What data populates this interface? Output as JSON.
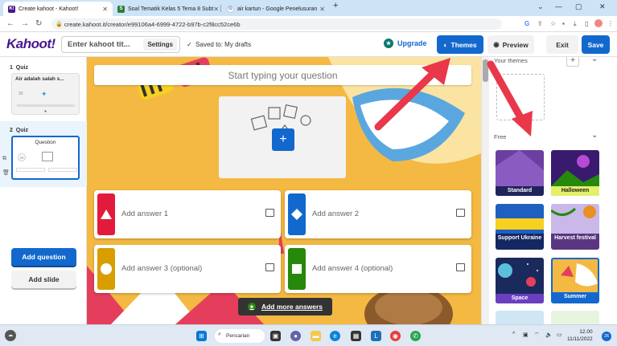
{
  "browser": {
    "tabs": [
      {
        "title": "Create kahoot - Kahoot!",
        "favicon": "K!",
        "active": true
      },
      {
        "title": "Soal Tematik Kelas 5 Tema 8 Subt",
        "favicon": "S",
        "active": false
      },
      {
        "title": "air kartun - Google Penelusuran",
        "favicon": "G",
        "active": false
      }
    ],
    "new_tab": "+",
    "url": "create.kahoot.it/creator/e99106a4-6999-4722-b97b-c2f8cc52ce6b"
  },
  "header": {
    "logo": "Kahoot!",
    "title_placeholder": "Enter kahoot tit...",
    "settings_label": "Settings",
    "saved_status": "Saved to: My drafts",
    "upgrade_label": "Upgrade",
    "themes_label": "Themes",
    "preview_label": "Preview",
    "exit_label": "Exit",
    "save_label": "Save"
  },
  "sidebar": {
    "slides": [
      {
        "index": "1",
        "type": "Quiz",
        "title": "Air adalah salah s...",
        "time": "20"
      },
      {
        "index": "2",
        "type": "Quiz",
        "title": "Question",
        "time": "20"
      }
    ],
    "add_question_label": "Add question",
    "add_slide_label": "Add slide"
  },
  "editor": {
    "question_placeholder": "Start typing your question",
    "answers": [
      {
        "placeholder": "Add answer 1",
        "shape": "triangle",
        "color": "#e21b3c"
      },
      {
        "placeholder": "Add answer 2",
        "shape": "diamond",
        "color": "#1368ce"
      },
      {
        "placeholder": "Add answer 3 (optional)",
        "shape": "circle",
        "color": "#d89e00"
      },
      {
        "placeholder": "Add answer 4 (optional)",
        "shape": "square",
        "color": "#26890c"
      }
    ],
    "more_answers_label": "Add more answers"
  },
  "themes_panel": {
    "your_themes_label": "Your themes",
    "free_label": "Free",
    "themes": [
      {
        "name": "Standard",
        "bg": "#6b3fa0"
      },
      {
        "name": "Halloween",
        "bg": "#3a1a6e"
      },
      {
        "name": "Support Ukraine",
        "bg": "#1f5fc0"
      },
      {
        "name": "Harvest festival",
        "bg": "#c9b8e8"
      },
      {
        "name": "Space",
        "bg": "#1b2a5c"
      },
      {
        "name": "Summer",
        "bg": "#f4b942",
        "selected": true
      }
    ]
  },
  "taskbar": {
    "search_label": "Pencarian",
    "time": "12.00",
    "date": "11/11/2022",
    "notification_count": "26"
  }
}
